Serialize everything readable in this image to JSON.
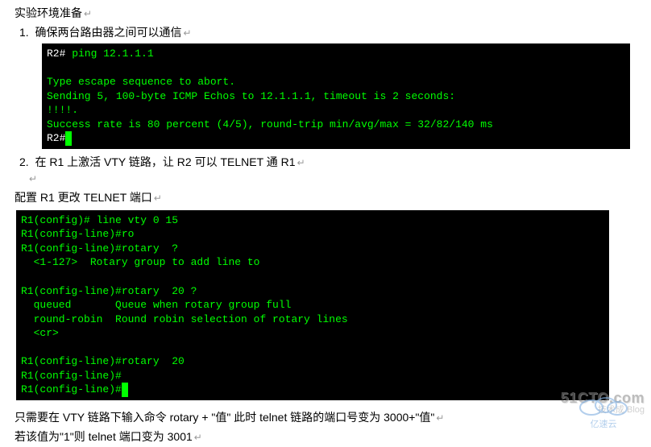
{
  "heading": "实验环境准备",
  "item1_num": "1.",
  "item1_text": "确保两台路由器之间可以通信",
  "terminal1_line1_prefix": "R2#",
  "terminal1_line1_cmd": " ping 12.1.1.1",
  "terminal1_block": "Type escape sequence to abort.\nSending 5, 100-byte ICMP Echos to 12.1.1.1, timeout is 2 seconds:\n!!!!.\nSuccess rate is 80 percent (4/5), round-trip min/avg/max = 32/82/140 ms",
  "terminal1_lastprompt": "R2#",
  "item2_num": "2.",
  "item2_text": "在 R1 上激活 VTY 链路，让 R2 可以 TELNET 通  R1",
  "config_heading": "配置 R1 更改 TELNET 端口",
  "terminal2": "R1(config)# line vty 0 15\nR1(config-line)#ro\nR1(config-line)#rotary  ?\n  <1-127>  Rotary group to add line to\n\nR1(config-line)#rotary  20 ?\n  queued       Queue when rotary group full\n  round-robin  Round robin selection of rotary lines\n  <cr>\n\nR1(config-line)#rotary  20\nR1(config-line)#",
  "terminal2_lastprompt": "R1(config-line)#",
  "bottom_line1": "只需要在 VTY 链路下输入命令  rotary + \"值\"   此时 telnet 链路的端口号变为  3000+\"值\"",
  "bottom_line2": "若该值为\"1\"则  telnet 端口变为 3001",
  "watermark_main": "51CTO.com",
  "watermark_sub": "技术成 Blog",
  "watermark_sub2": "亿速云",
  "paragraph_mark": "↵"
}
